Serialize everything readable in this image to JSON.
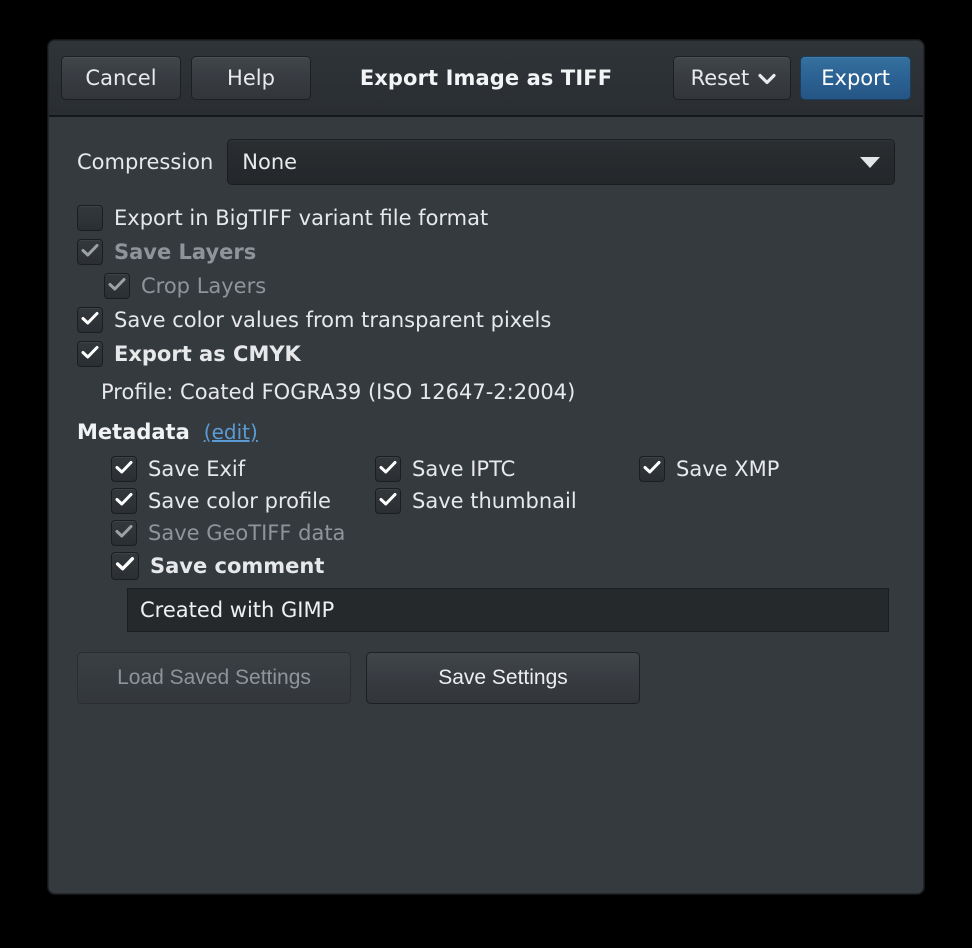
{
  "dialog": {
    "title": "Export Image as TIFF"
  },
  "header": {
    "cancel_label": "Cancel",
    "help_label": "Help",
    "reset_label": "Reset",
    "reset_icon": "chevron-down-icon",
    "export_label": "Export",
    "export_accent_color": "#2c6394"
  },
  "compression": {
    "label": "Compression",
    "value": "None",
    "dropdown_icon": "caret-down-icon"
  },
  "options": [
    {
      "id": "bigtiff",
      "label": "Export in BigTIFF variant file format",
      "checked": false,
      "disabled": false,
      "bold": false,
      "indent": 0
    },
    {
      "id": "save-layers",
      "label": "Save Layers",
      "checked": true,
      "disabled": true,
      "bold": true,
      "indent": 0
    },
    {
      "id": "crop-layers",
      "label": "Crop Layers",
      "checked": true,
      "disabled": true,
      "bold": false,
      "indent": 1
    },
    {
      "id": "save-transparent-color-values",
      "label": "Save color values from transparent pixels",
      "checked": true,
      "disabled": false,
      "bold": false,
      "indent": 0
    },
    {
      "id": "export-as-cmyk",
      "label": "Export as CMYK",
      "checked": true,
      "disabled": false,
      "bold": true,
      "indent": 0
    }
  ],
  "profile": {
    "text": "Profile: Coated FOGRA39 (ISO 12647-2:2004)"
  },
  "metadata": {
    "title": "Metadata",
    "edit_label": "(edit)",
    "edit_link_color": "#5b9bd5",
    "items": [
      {
        "id": "save-exif",
        "label": "Save Exif",
        "checked": true,
        "disabled": false
      },
      {
        "id": "save-iptc",
        "label": "Save IPTC",
        "checked": true,
        "disabled": false
      },
      {
        "id": "save-xmp",
        "label": "Save XMP",
        "checked": true,
        "disabled": false
      },
      {
        "id": "save-color-profile",
        "label": "Save color profile",
        "checked": true,
        "disabled": false
      },
      {
        "id": "save-thumbnail",
        "label": "Save thumbnail",
        "checked": true,
        "disabled": false
      },
      {
        "id": "save-geotiff-data",
        "label": "Save GeoTIFF data",
        "checked": true,
        "disabled": true
      }
    ],
    "comment": {
      "label": "Save comment",
      "checked": true,
      "bold": true,
      "value": "Created with GIMP"
    }
  },
  "footer": {
    "load_settings_label": "Load Saved Settings",
    "load_settings_disabled": true,
    "save_settings_label": "Save Settings",
    "save_settings_disabled": false
  }
}
